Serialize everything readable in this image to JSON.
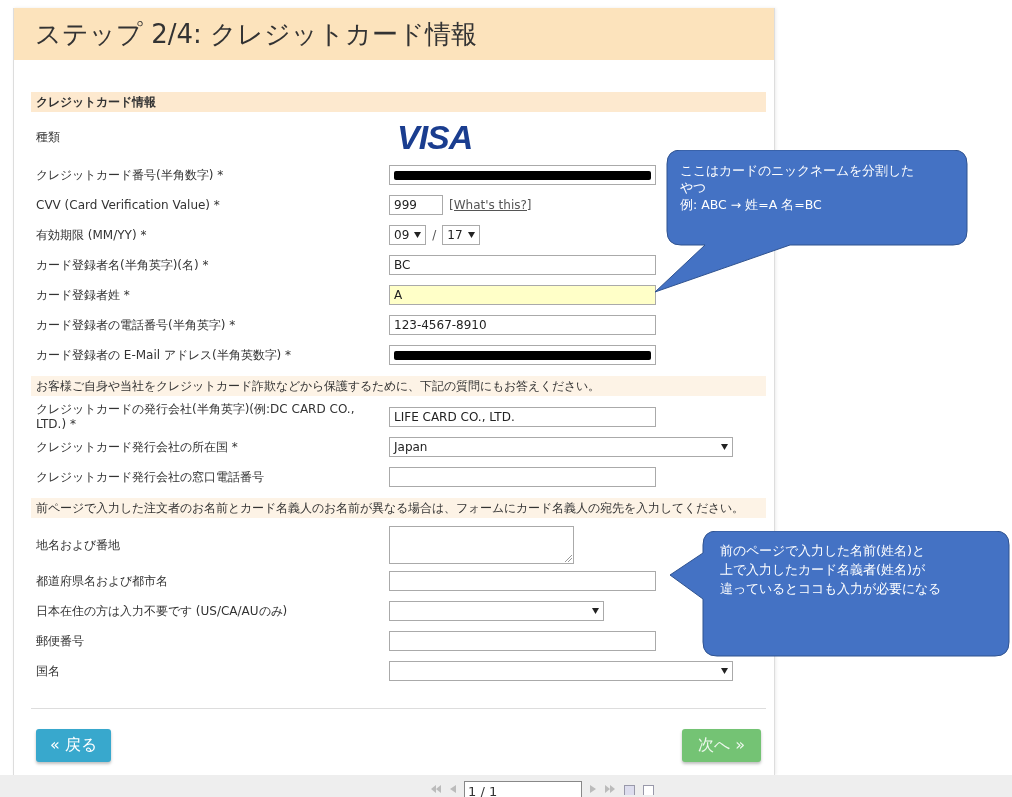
{
  "header": {
    "title": "ステップ 2/4: クレジットカード情報"
  },
  "section_title": "クレジットカード情報",
  "rows": [
    {
      "kind": "logo",
      "label": "種類",
      "logo_text": "VISA"
    },
    {
      "kind": "redacted",
      "label": "クレジットカード番号(半角数字) *"
    },
    {
      "kind": "cvv",
      "label": "CVV (Card Verification Value) *",
      "value": "999",
      "link": "[What's this?]"
    },
    {
      "kind": "expiry",
      "label": "有効期限 (MM/YY) *",
      "month": "09",
      "separator": "/",
      "year": "17"
    },
    {
      "kind": "text",
      "label": "カード登録者名(半角英字)(名) *",
      "value": "BC",
      "highlighted": false
    },
    {
      "kind": "text",
      "label": "カード登録者姓 *",
      "value": "A",
      "highlighted": true
    },
    {
      "kind": "text",
      "label": "カード登録者の電話番号(半角英字) *",
      "value": "123-4567-8910",
      "highlighted": false
    },
    {
      "kind": "redacted",
      "label": "カード登録者の E-Mail アドレス(半角英数字) *"
    },
    {
      "kind": "notice",
      "text": "お客様ご自身や当社をクレジットカード詐欺などから保護するために、下記の質問にもお答えください。"
    },
    {
      "kind": "text",
      "label": "クレジットカードの発行会社(半角英字)(例:DC CARD CO., LTD.) *",
      "value": "LIFE CARD CO., LTD.",
      "highlighted": false
    },
    {
      "kind": "select",
      "label": "クレジットカード発行会社の所在国 *",
      "value": "Japan"
    },
    {
      "kind": "text",
      "label": "クレジットカード発行会社の窓口電話番号",
      "highlighted": false
    },
    {
      "kind": "notice",
      "text": "前ページで入力した注文者のお名前とカード名義人のお名前が異なる場合は、フォームにカード名義人の宛先を入力してください。"
    },
    {
      "kind": "textarea",
      "label": "地名および番地"
    },
    {
      "kind": "text",
      "label": "都道府県名および都市名",
      "highlighted": false
    },
    {
      "kind": "short_select",
      "label": "日本在住の方は入力不要です (US/CA/AUのみ)"
    },
    {
      "kind": "text",
      "label": "郵便番号",
      "highlighted": false
    },
    {
      "kind": "select",
      "label": "国名"
    }
  ],
  "buttons": {
    "back": "« 戻る",
    "next": "次へ »"
  },
  "callouts": [
    {
      "lines": [
        "ここはカードのニックネームを分割した",
        "やつ",
        "例:  ABC  →  姓=A  名=BC"
      ]
    },
    {
      "lines": [
        "前のページで入力した名前(姓名)と",
        "上で入力したカード名義者(姓名)が",
        "違っているとココも入力が必要になる"
      ]
    }
  ],
  "viewer": {
    "page": "1 / 1"
  }
}
